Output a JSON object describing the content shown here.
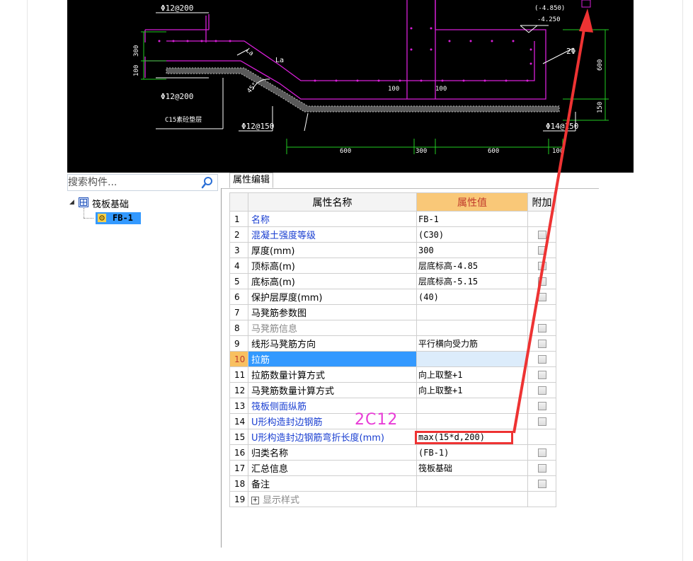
{
  "cad": {
    "labels": {
      "rebar_top_left": "Φ12@200",
      "rebar_bottom_left": "Φ12@200",
      "rebar_bottom_mid": "Φ12@150",
      "rebar_right": "Φ14@150",
      "rebar_side": "2Φ",
      "cushion": "C15素砼垫层",
      "elev_upper": "(-4.850)",
      "elev_lower": "-4.250",
      "la_small": "La",
      "la_main": "La",
      "angle": "45°",
      "dim_300_v": "300",
      "dim_100_v": "100",
      "dim_100_a": "100",
      "dim_100_b": "100",
      "dim_600_v": "600",
      "dim_150_v": "150",
      "dim_600_a": "600",
      "dim_300_h": "300",
      "dim_600_b": "600",
      "dim_100_c": "100"
    }
  },
  "search": {
    "placeholder": "搜索构件..."
  },
  "tree": {
    "root_label": "筏板基础",
    "child_label": "FB-1"
  },
  "panel": {
    "tab_label": "属性编辑",
    "columns": {
      "name": "属性名称",
      "value": "属性值",
      "extra": "附加"
    },
    "rows": [
      {
        "num": "1",
        "name": "名称",
        "value": "FB-1",
        "style": "blue",
        "checkbox": false
      },
      {
        "num": "2",
        "name": "混凝土强度等级",
        "value": "(C30)",
        "style": "blue",
        "checkbox": true
      },
      {
        "num": "3",
        "name": "厚度(mm)",
        "value": "300",
        "style": "black",
        "checkbox": true
      },
      {
        "num": "4",
        "name": "顶标高(m)",
        "value": "层底标高-4.85",
        "style": "black",
        "checkbox": true
      },
      {
        "num": "5",
        "name": "底标高(m)",
        "value": "层底标高-5.15",
        "style": "black",
        "checkbox": true
      },
      {
        "num": "6",
        "name": "保护层厚度(mm)",
        "value": "(40)",
        "style": "black",
        "checkbox": true
      },
      {
        "num": "7",
        "name": "马凳筋参数图",
        "value": "",
        "style": "black",
        "checkbox": false
      },
      {
        "num": "8",
        "name": "马凳筋信息",
        "value": "",
        "style": "gray",
        "checkbox": true
      },
      {
        "num": "9",
        "name": "线形马凳筋方向",
        "value": "平行横向受力筋",
        "style": "black",
        "checkbox": true
      },
      {
        "num": "10",
        "name": "拉筋",
        "value": "",
        "style": "selected",
        "checkbox": true
      },
      {
        "num": "11",
        "name": "拉筋数量计算方式",
        "value": "向上取整+1",
        "style": "black",
        "checkbox": true
      },
      {
        "num": "12",
        "name": "马凳筋数量计算方式",
        "value": "向上取整+1",
        "style": "black",
        "checkbox": true
      },
      {
        "num": "13",
        "name": "筏板侧面纵筋",
        "value": "",
        "style": "blue",
        "checkbox": true
      },
      {
        "num": "14",
        "name": "U形构造封边钢筋",
        "value": "",
        "style": "blue",
        "checkbox": true
      },
      {
        "num": "15",
        "name": "U形构造封边钢筋弯折长度(mm)",
        "value": "max(15*d,200)",
        "style": "blue",
        "checkbox": false
      },
      {
        "num": "16",
        "name": "归类名称",
        "value": "(FB-1)",
        "style": "black",
        "checkbox": true
      },
      {
        "num": "17",
        "name": "汇总信息",
        "value": "筏板基础",
        "style": "black",
        "checkbox": true
      },
      {
        "num": "18",
        "name": "备注",
        "value": "",
        "style": "black",
        "checkbox": true
      },
      {
        "num": "19",
        "name": "显示样式",
        "value": "",
        "style": "gray",
        "checkbox": false,
        "expander": "+"
      }
    ]
  },
  "annotation": {
    "text": "2C12",
    "color": "#e83cd6",
    "box_color": "#ee3333",
    "arrow_color": "#ee3333"
  },
  "colors": {
    "selected_row": "#3399ff",
    "value_header": "#f9c878",
    "cad_outline": "#e040fb",
    "cad_dim": "#22cc22"
  }
}
